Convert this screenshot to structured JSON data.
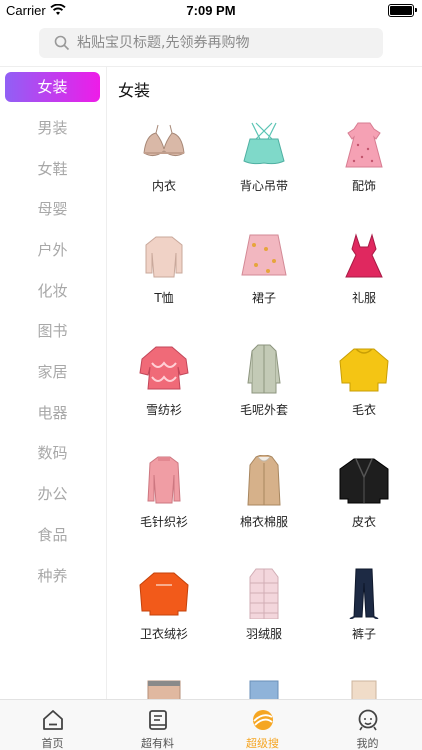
{
  "status_bar": {
    "carrier": "Carrier",
    "time": "7:09 PM"
  },
  "search": {
    "placeholder": "粘贴宝贝标题,先领券再购物"
  },
  "sidebar": {
    "items": [
      {
        "label": "女装",
        "active": true
      },
      {
        "label": "男装"
      },
      {
        "label": "女鞋"
      },
      {
        "label": "母婴"
      },
      {
        "label": "户外"
      },
      {
        "label": "化妆"
      },
      {
        "label": "图书"
      },
      {
        "label": "家居"
      },
      {
        "label": "电器"
      },
      {
        "label": "数码"
      },
      {
        "label": "办公"
      },
      {
        "label": "食品"
      },
      {
        "label": "种养"
      }
    ]
  },
  "content": {
    "section_title": "女装",
    "items": [
      {
        "label": "内衣",
        "icon": "bra-icon"
      },
      {
        "label": "背心吊带",
        "icon": "camisole-icon"
      },
      {
        "label": "配饰",
        "icon": "dress-icon"
      },
      {
        "label": "T恤",
        "icon": "tshirt-icon"
      },
      {
        "label": "裙子",
        "icon": "skirt-icon"
      },
      {
        "label": "礼服",
        "icon": "gown-icon"
      },
      {
        "label": "雪纺衫",
        "icon": "chiffon-blouse-icon"
      },
      {
        "label": "毛呢外套",
        "icon": "wool-coat-icon"
      },
      {
        "label": "毛衣",
        "icon": "sweater-icon"
      },
      {
        "label": "毛针织衫",
        "icon": "knit-top-icon"
      },
      {
        "label": "棉衣棉服",
        "icon": "cotton-coat-icon"
      },
      {
        "label": "皮衣",
        "icon": "leather-jacket-icon"
      },
      {
        "label": "卫衣绒衫",
        "icon": "hoodie-icon"
      },
      {
        "label": "羽绒服",
        "icon": "down-jacket-icon"
      },
      {
        "label": "裤子",
        "icon": "pants-icon"
      },
      {
        "label": "",
        "icon": "partial-item-icon"
      },
      {
        "label": "",
        "icon": "jeans-icon"
      },
      {
        "label": "",
        "icon": "partial-item-icon"
      }
    ]
  },
  "tabbar": {
    "tabs": [
      {
        "label": "首页",
        "icon": "home-icon"
      },
      {
        "label": "超有料",
        "icon": "notebook-icon"
      },
      {
        "label": "超级搜",
        "icon": "search-ball-icon",
        "active": true
      },
      {
        "label": "我的",
        "icon": "profile-icon"
      }
    ]
  },
  "colors": {
    "accent_start": "#9160f5",
    "accent_end": "#ee1ce8",
    "tab_active": "#f5a623"
  }
}
